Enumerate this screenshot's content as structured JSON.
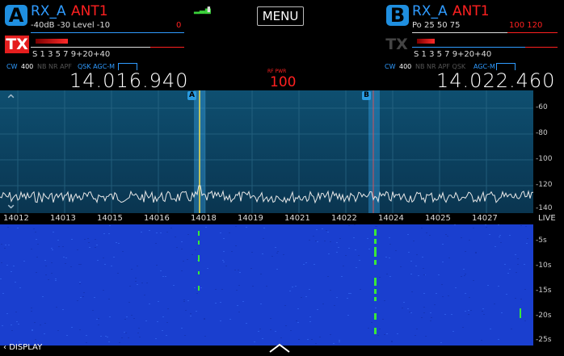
{
  "vfo_a": {
    "badge": "A",
    "rx": "RX_A",
    "ant": "ANT1",
    "tx": "TX",
    "meter_top": "-40dB -30  Level  -10",
    "meter_zero": "0",
    "s_scale": "S   1   3   5   7   9+20+40",
    "mode": "CW",
    "bandwidth": "400",
    "flags_dim": "NB NR APF",
    "flags_lit": "QSK AGC-M",
    "frequency": "14.016.940"
  },
  "vfo_b": {
    "badge": "B",
    "rx": "RX_A",
    "ant": "ANT1",
    "tx": "TX",
    "meter_top": "Po  25   50   75",
    "meter_top_red": "100 120",
    "s_scale": "S   1   3   5   7   9+20+40",
    "mode": "CW",
    "bandwidth": "400",
    "flags_dim": "NB NR APF QSK",
    "flags_lit": "AGC-M",
    "frequency": "14.022.460"
  },
  "center": {
    "menu_label": "MENU",
    "rf_pwr_label": "RF PWR",
    "rf_pwr_value": "100"
  },
  "spectrum": {
    "marker_a": "A",
    "marker_b": "B",
    "db_labels": [
      "-60",
      "-80",
      "-100",
      "-120",
      "-140"
    ],
    "freq_labels": [
      "14012",
      "14013",
      "14015",
      "14016",
      "14018",
      "14019",
      "14021",
      "14022",
      "14024",
      "14025",
      "14027"
    ],
    "live_label": "LIVE"
  },
  "waterfall": {
    "time_labels": [
      "-5s",
      "-10s",
      "-15s",
      "-20s",
      "-25s"
    ]
  },
  "bottom": {
    "display_label": "DISPLAY"
  },
  "colors": {
    "vfo_blue": "#1f8fe0",
    "tx_red": "#e51e1e",
    "waterfall_blue": "#1a3fcf"
  }
}
